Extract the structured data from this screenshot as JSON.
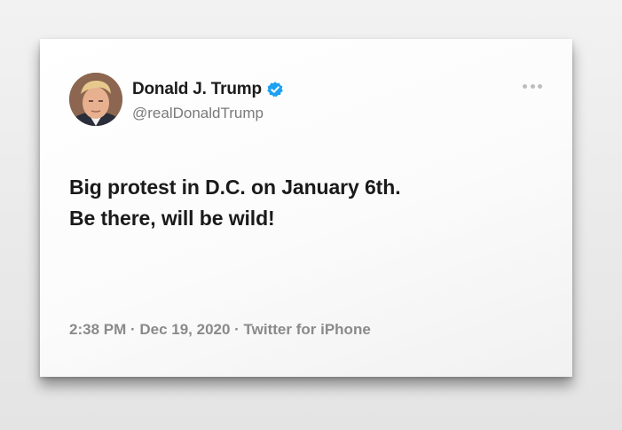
{
  "tweet": {
    "author": {
      "display_name": "Donald J. Trump",
      "handle": "@realDonaldTrump",
      "verified": true,
      "avatar_icon": "profile-photo"
    },
    "text_lines": [
      "Big protest in D.C. on January 6th.",
      "Be there, will be wild!"
    ],
    "timestamp": "2:38 PM · Dec 19, 2020 · Twitter for iPhone",
    "more_icon": "ellipsis-icon"
  },
  "colors": {
    "verified_blue": "#1da1f2",
    "text_primary": "#1a1a1a",
    "text_secondary": "#7a7a7a"
  }
}
